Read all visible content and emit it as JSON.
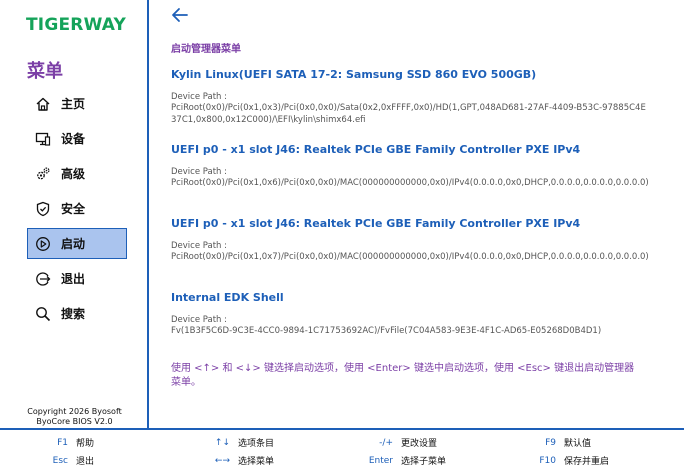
{
  "brand": {
    "logo_text": "TIGERWAY",
    "logo_color": "#15a35a"
  },
  "sidebar": {
    "title": "菜单",
    "items": [
      {
        "label": "主页",
        "icon": "home-icon",
        "active": false
      },
      {
        "label": "设备",
        "icon": "devices-icon",
        "active": false
      },
      {
        "label": "高级",
        "icon": "gears-icon",
        "active": false
      },
      {
        "label": "安全",
        "icon": "shield-icon",
        "active": false
      },
      {
        "label": "启动",
        "icon": "boot-icon",
        "active": true
      },
      {
        "label": "退出",
        "icon": "exit-icon",
        "active": false
      },
      {
        "label": "搜索",
        "icon": "search-icon",
        "active": false
      }
    ],
    "copyright_line1": "Copyright 2026 Byosoft",
    "copyright_line2": "ByoCore BIOS V2.0"
  },
  "main": {
    "heading": "启动管理器菜单",
    "entries": [
      {
        "title": "Kylin Linux(UEFI SATA 17-2: Samsung SSD 860 EVO 500GB)",
        "path_label": "Device Path :",
        "path": "PciRoot(0x0)/Pci(0x1,0x3)/Pci(0x0,0x0)/Sata(0x2,0xFFFF,0x0)/HD(1,GPT,048AD681-27AF-4409-B53C-97885C4E37C1,0x800,0x12C000)/\\EFI\\kylin\\shimx64.efi"
      },
      {
        "title": "UEFI p0 - x1 slot J46: Realtek PCIe GBE Family Controller PXE IPv4",
        "path_label": "Device Path :",
        "path": "PciRoot(0x0)/Pci(0x1,0x6)/Pci(0x0,0x0)/MAC(000000000000,0x0)/IPv4(0.0.0.0,0x0,DHCP,0.0.0.0,0.0.0.0,0.0.0.0)"
      },
      {
        "title": "UEFI p0 - x1 slot J46: Realtek PCIe GBE Family Controller PXE IPv4",
        "path_label": "Device Path :",
        "path": "PciRoot(0x0)/Pci(0x1,0x7)/Pci(0x0,0x0)/MAC(000000000000,0x0)/IPv4(0.0.0.0,0x0,DHCP,0.0.0.0,0.0.0.0,0.0.0.0)"
      },
      {
        "title": "Internal EDK Shell",
        "path_label": "Device Path :",
        "path": "Fv(1B3F5C6D-9C3E-4CC0-9894-1C71753692AC)/FvFile(7C04A583-9E3E-4F1C-AD65-E05268D0B4D1)"
      }
    ],
    "help": "使用 <↑> 和 <↓> 键选择启动选项，使用 <Enter> 键选中启动选项，使用 <Esc> 键退出启动管理器菜单。"
  },
  "footer": [
    {
      "key": "F1",
      "desc": "帮助"
    },
    {
      "key": "Esc",
      "desc": "退出"
    },
    {
      "key": "↑↓",
      "desc": "选项条目"
    },
    {
      "key": "←→",
      "desc": "选择菜单"
    },
    {
      "key": "-/+",
      "desc": "更改设置"
    },
    {
      "key": "Enter",
      "desc": "选择子菜单"
    },
    {
      "key": "F9",
      "desc": "默认值"
    },
    {
      "key": "F10",
      "desc": "保存并重启"
    }
  ],
  "colors": {
    "accent": "#1d5fb8",
    "heading": "#7b3fa6",
    "active_bg": "#aac4ee"
  }
}
